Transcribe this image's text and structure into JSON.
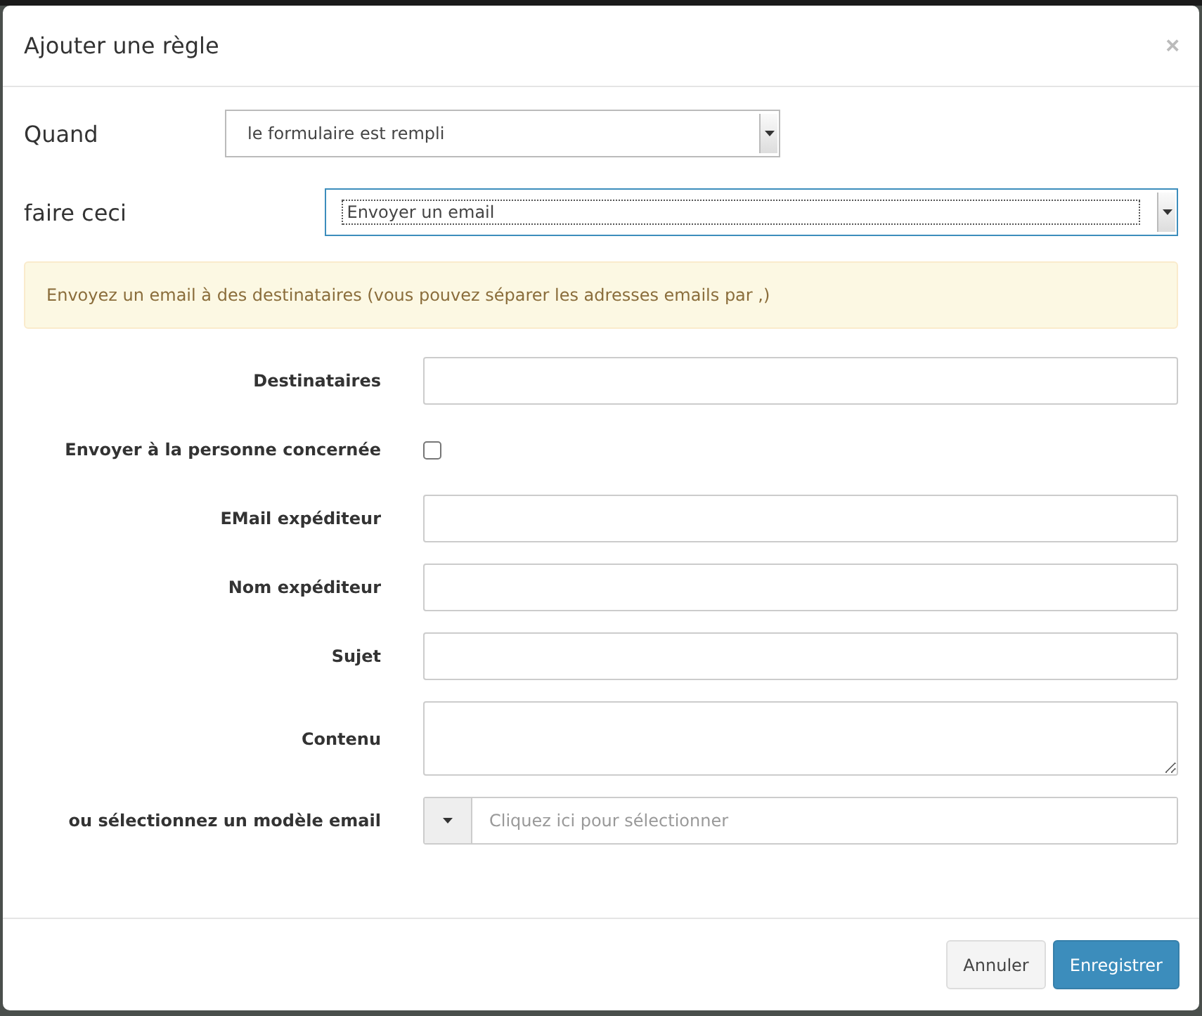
{
  "dialog": {
    "title": "Ajouter une règle",
    "close": "×"
  },
  "when": {
    "label": "Quand",
    "value": "le formulaire est rempli"
  },
  "action": {
    "label": "faire ceci",
    "value": "Envoyer un email",
    "focused": true
  },
  "alert": "Envoyez un email à des destinataires (vous pouvez séparer les adresses emails par ,)",
  "fields": [
    {
      "kind": "text",
      "label": "Destinataires"
    },
    {
      "kind": "checkbox",
      "label": "Envoyer à la personne concernée",
      "checked": false
    },
    {
      "kind": "text",
      "label": "EMail expéditeur"
    },
    {
      "kind": "text",
      "label": "Nom expéditeur"
    },
    {
      "kind": "text",
      "label": "Sujet"
    },
    {
      "kind": "textarea",
      "label": "Contenu"
    },
    {
      "kind": "template",
      "label": "ou sélectionnez un modèle email",
      "placeholder": "Cliquez ici pour sélectionner"
    }
  ],
  "buttons": [
    {
      "label": "Annuler",
      "primary": false
    },
    {
      "label": "Enregistrer",
      "primary": true
    }
  ]
}
